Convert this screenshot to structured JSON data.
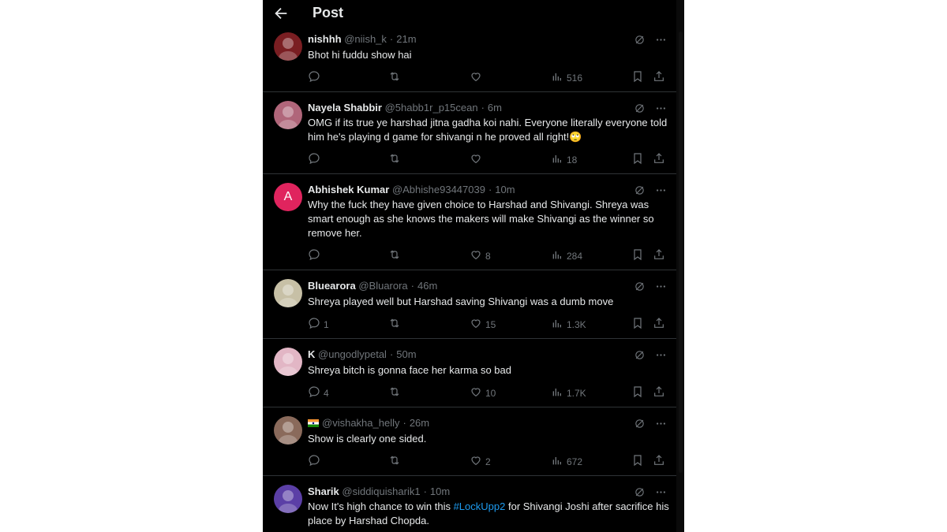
{
  "header": {
    "title": "Post",
    "back_icon": "arrow-left-icon"
  },
  "colors": {
    "background": "#000000",
    "text": "#e7e9ea",
    "muted": "#71767b",
    "link": "#1d9bf0",
    "divider": "#2f3336"
  },
  "posts": [
    {
      "name": "nishhh",
      "handle": "@niish_k",
      "time": "21m",
      "text": "Bhot hi fuddu show hai",
      "replies": "",
      "likes": "",
      "views": "516",
      "avatar": "avatar-anime-girl"
    },
    {
      "name": "Nayela Shabbir",
      "handle": "@5habb1r_p15cean",
      "time": "6m",
      "text": "OMG if its true ye harshad jitna gadha koi nahi. Everyone literally everyone told him he's playing d game for shivangi n he proved all right!🙄",
      "replies": "",
      "likes": "",
      "views": "18",
      "avatar": "avatar-photo"
    },
    {
      "name": "Abhishek Kumar",
      "handle": "@Abhishe93447039",
      "time": "10m",
      "text": "Why the fuck they have given choice to Harshad and Shivangi. Shreya was smart enough as she knows the makers will make Shivangi as the winner so remove her.",
      "replies": "",
      "likes": "8",
      "views": "284",
      "avatar": "avatar-letter",
      "avatar_letter": "A"
    },
    {
      "name": "Bluearora",
      "handle": "@Bluarora",
      "time": "46m",
      "text": "Shreya played well but Harshad saving Shivangi was a dumb move",
      "replies": "1",
      "likes": "15",
      "views": "1.3K",
      "avatar": "avatar-photo"
    },
    {
      "name": "K",
      "handle": "@ungodlypetal",
      "time": "50m",
      "text": "Shreya bitch is gonna face her karma so bad",
      "replies": "4",
      "likes": "10",
      "views": "1.7K",
      "avatar": "avatar-photo"
    },
    {
      "name": "",
      "handle": "@vishakha_helly",
      "time": "26m",
      "text": "Show is clearly one sided.",
      "replies": "",
      "likes": "2",
      "views": "672",
      "avatar": "avatar-photo"
    },
    {
      "name": "Sharik",
      "handle": "@siddiquisharik1",
      "time": "10m",
      "text_before": "Now It's high chance to win this ",
      "hashtag": "#LockUpp2",
      "text_after": " for Shivangi Joshi after sacrifice his place by Harshad Chopda.",
      "avatar": "avatar-photo"
    }
  ],
  "separator": "·"
}
